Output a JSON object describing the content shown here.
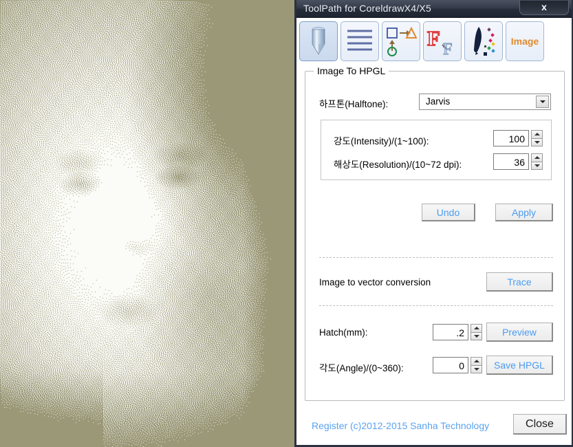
{
  "window": {
    "title": "ToolPath for CoreldrawX4/X5",
    "close_glyph": "x",
    "close_icon_name": "window-close-icon"
  },
  "toolbar": {
    "buttons": [
      {
        "name": "tool-pen",
        "icon": "engraving-bit-icon",
        "label": "",
        "selected": true
      },
      {
        "name": "tool-hatch-fill",
        "icon": "horizontal-lines-icon",
        "label": "",
        "selected": false
      },
      {
        "name": "tool-shapes",
        "icon": "shape-convert-icon",
        "label": "",
        "selected": false
      },
      {
        "name": "tool-text",
        "icon": "font-outline-icon",
        "label": "",
        "selected": false
      },
      {
        "name": "tool-brush",
        "icon": "brush-color-icon",
        "label": "",
        "selected": false
      },
      {
        "name": "tool-image",
        "icon": "image-text-icon",
        "label": "Image",
        "selected": false
      }
    ]
  },
  "group": {
    "legend": "Image To HPGL"
  },
  "halftone": {
    "label": "하프톤(Halftone):",
    "value": "Jarvis",
    "options": [
      "Jarvis"
    ],
    "arrow_icon": "chevron-down-icon"
  },
  "intensity": {
    "label": "강도(Intensity)/(1~100):",
    "value": "100"
  },
  "resolution": {
    "label": "해상도(Resolution)/(10~72 dpi):",
    "value": "36"
  },
  "actions": {
    "undo_label": "Undo",
    "apply_label": "Apply"
  },
  "vector": {
    "label": "Image to vector conversion",
    "trace_label": "Trace"
  },
  "hatch": {
    "label": "Hatch(mm):",
    "value": ".2",
    "button_label": "Preview"
  },
  "angle": {
    "label": "각도(Angle)/(0~360):",
    "value": "0",
    "button_label": "Save HPGL"
  },
  "footer": {
    "register_text": "Register  (c)2012-2015 Sanha Technology",
    "close_label": "Close"
  },
  "preview": {
    "description": "Halftone dithered portrait preview",
    "dither_color": "#9a9877",
    "background_color": "#fbfbf7",
    "mode": "Jarvis dither"
  },
  "colors": {
    "titlebar": "#2b3140",
    "button_text": "#4a9bf0",
    "register_text": "#5aa3ee",
    "image_label": "#e08a30"
  }
}
